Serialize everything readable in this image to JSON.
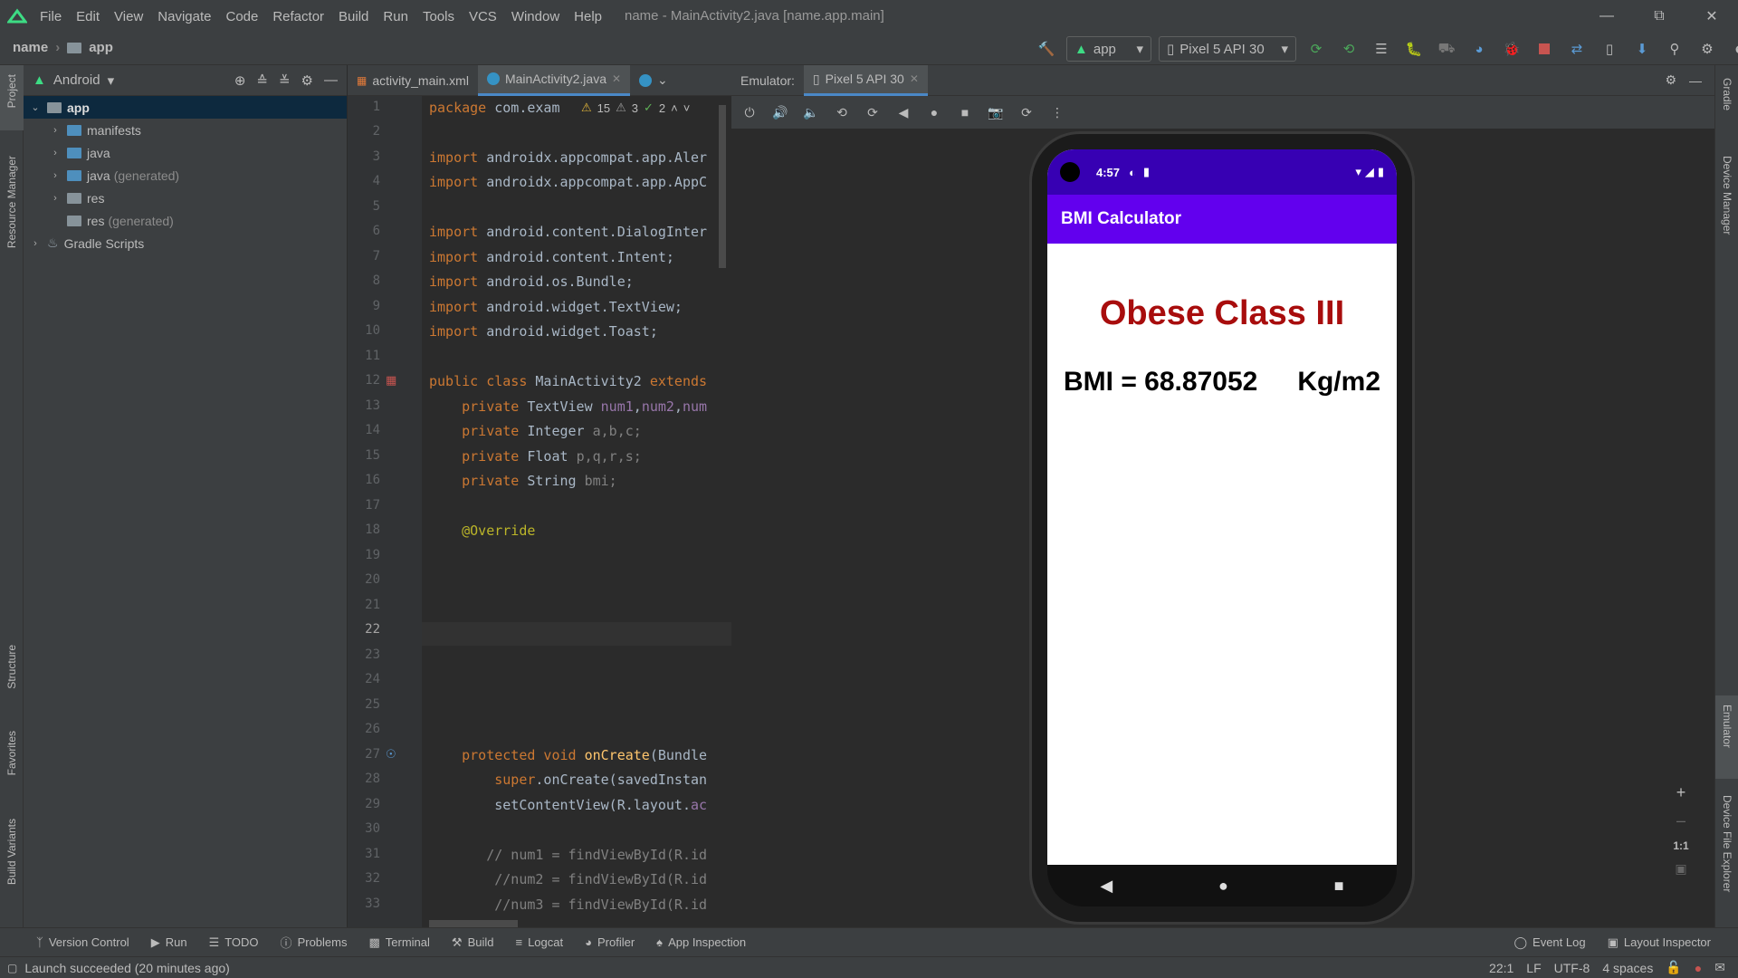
{
  "menubar": {
    "items": [
      "File",
      "Edit",
      "View",
      "Navigate",
      "Code",
      "Refactor",
      "Build",
      "Run",
      "Tools",
      "VCS",
      "Window",
      "Help"
    ],
    "title": "name - MainActivity2.java [name.app.main]"
  },
  "navbar": {
    "project": "name",
    "module": "app",
    "run_config": "app",
    "device": "Pixel 5 API 30"
  },
  "left_strip": {
    "project": "Project",
    "resource_manager": "Resource Manager",
    "structure": "Structure",
    "favorites": "Favorites",
    "build_variants": "Build Variants"
  },
  "right_strip": {
    "gradle": "Gradle",
    "device_manager": "Device Manager",
    "emulator": "Emulator",
    "device_file_explorer": "Device File Explorer"
  },
  "project_panel": {
    "view": "Android",
    "tree": [
      {
        "label": "app",
        "suffix": ""
      },
      {
        "label": "manifests",
        "suffix": ""
      },
      {
        "label": "java",
        "suffix": ""
      },
      {
        "label": "java",
        "suffix": "(generated)"
      },
      {
        "label": "res",
        "suffix": ""
      },
      {
        "label": "res",
        "suffix": "(generated)"
      },
      {
        "label": "Gradle Scripts",
        "suffix": ""
      }
    ]
  },
  "editor": {
    "tabs": [
      "activity_main.xml",
      "MainActivity2.java"
    ],
    "inspections": {
      "warnings": "15",
      "weak_warnings": "3",
      "ok": "2"
    },
    "current_line": 22
  },
  "emulator": {
    "label": "Emulator:",
    "device_tab": "Pixel 5 API 30",
    "phone": {
      "time": "4:57",
      "app_title": "BMI Calculator",
      "result": "Obese Class III",
      "bmi_text": "BMI = 68.87052",
      "unit": "Kg/m2"
    },
    "zoom_ratio": "1:1"
  },
  "bottom_tools": [
    "Version Control",
    "Run",
    "TODO",
    "Problems",
    "Terminal",
    "Build",
    "Logcat",
    "Profiler",
    "App Inspection"
  ],
  "bottom_right_tools": [
    "Event Log",
    "Layout Inspector"
  ],
  "status": {
    "message": "Launch succeeded (20 minutes ago)",
    "position": "22:1",
    "line_sep": "LF",
    "encoding": "UTF-8",
    "indent": "4 spaces"
  },
  "colors": {
    "accent": "#4a88c7",
    "app_bar": "#6200ee",
    "status_bar": "#3700b3",
    "result_red": "#a80d0d"
  }
}
